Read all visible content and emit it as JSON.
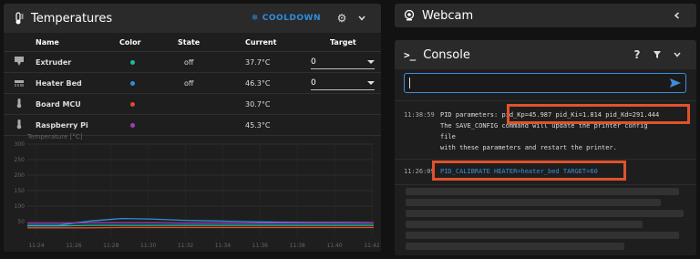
{
  "temperatures": {
    "title": "Temperatures",
    "cooldown_label": "COOLDOWN",
    "columns": [
      "Name",
      "Color",
      "State",
      "Current",
      "Target"
    ],
    "rows": [
      {
        "name": "Extruder",
        "color": "#1abc9c",
        "state": "off",
        "current": "37.7°C",
        "target": "0"
      },
      {
        "name": "Heater Bed",
        "color": "#2f8ee0",
        "state": "off",
        "current": "46.3°C",
        "target": "0"
      },
      {
        "name": "Board MCU",
        "color": "#e04a2f",
        "state": "",
        "current": "30.7°C",
        "target": ""
      },
      {
        "name": "Raspberry Pi",
        "color": "#9b3fb5",
        "state": "",
        "current": "45.3°C",
        "target": ""
      }
    ]
  },
  "chart_data": {
    "type": "line",
    "ylabel": "Temperature [°C]",
    "ylim": [
      0,
      300
    ],
    "yticks": [
      50,
      100,
      150,
      200,
      250,
      300
    ],
    "x": [
      "11:24",
      "11:26",
      "11:28",
      "11:30",
      "11:32",
      "11:34",
      "11:36",
      "11:38",
      "11:40",
      "11:42"
    ],
    "series": [
      {
        "color": "#2f8ee0",
        "values": [
          38,
          38,
          52,
          60,
          58,
          54,
          52,
          50,
          48,
          47,
          47,
          46
        ]
      },
      {
        "color": "#1abc9c",
        "values": [
          36,
          36,
          38,
          38,
          38,
          38,
          38,
          38,
          38,
          38,
          38,
          38
        ]
      },
      {
        "color": "#e04a2f",
        "values": [
          30,
          30,
          30,
          31,
          31,
          31,
          31,
          31,
          31,
          31,
          31,
          31
        ]
      },
      {
        "color": "#9b3fb5",
        "values": [
          45,
          45,
          46,
          46,
          46,
          45,
          45,
          45,
          45,
          45,
          45,
          45
        ]
      }
    ]
  },
  "webcam": {
    "title": "Webcam"
  },
  "console": {
    "title": "Console",
    "help_label": "?",
    "entries": [
      {
        "time": "11:38:59",
        "line1_prefix": "PID parameters: ",
        "line1_highlight": "pid_Kp=45.987 pid_Ki=1.814 pid_Kd=291.444",
        "line2": "The SAVE_CONFIG command will update the printer config",
        "line3": "file",
        "line4": "with these parameters and restart the printer."
      },
      {
        "time": "11:26:09",
        "command": "PID_CALIBRATE HEATER=heater_bed TARGET=60"
      }
    ]
  },
  "colors": {
    "accent": "#2f8ee0",
    "highlight": "#e0522c"
  }
}
